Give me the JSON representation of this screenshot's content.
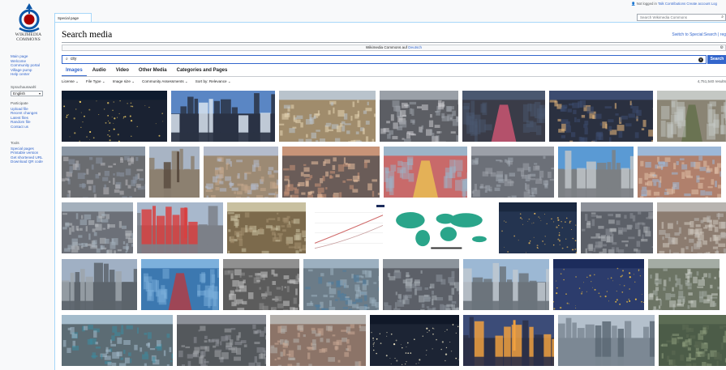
{
  "logo": {
    "line1": "WIKIMEDIA",
    "line2": "COMMONS"
  },
  "sidebar": {
    "nav": [
      "Main page",
      "Welcome",
      "Community portal",
      "Village pump",
      "Help center"
    ],
    "language_heading": "Sprachauswahl",
    "language_value": "English",
    "participate_heading": "Participate",
    "participate": [
      "Upload file",
      "Recent changes",
      "Latest files",
      "Random file",
      "Contact us"
    ],
    "tools_heading": "Tools",
    "tools": [
      "Special pages",
      "Printable version",
      "Get shortened URL",
      "Download QR code"
    ]
  },
  "topbar": {
    "user_status": "Not logged in",
    "links": [
      "Talk",
      "Contributions",
      "Create account",
      "Log"
    ],
    "search_placeholder": "Search Wikimedia Commons"
  },
  "page": {
    "tab": "Special page",
    "title": "Search media",
    "switch_link": "Switch to Special:Search | reg",
    "banner_text": "Wikimedia Commons auf ",
    "banner_link": "Deutsch",
    "query": "city",
    "search_button": "Search",
    "media_tabs": [
      "Images",
      "Audio",
      "Video",
      "Other Media",
      "Categories and Pages"
    ],
    "filters": [
      "License",
      "File Type",
      "Image size",
      "Community Assessments",
      "Sort by: Relevance"
    ],
    "results_count": "4,751,540 results"
  },
  "colors": {
    "link": "#3366cc",
    "accent": "#3366cc",
    "border": "#a7d7f9"
  },
  "thumbs": [
    {
      "alt": "city-lights-night-earth",
      "sky": "#0d1b2e",
      "ground": "#1a2232",
      "accent": "#e8c864",
      "style": "night"
    },
    {
      "alt": "manhattan-skyline-dusk",
      "sky": "#5a86c4",
      "ground": "#2a3244",
      "accent": "#d9e4f0",
      "style": "skyline"
    },
    {
      "alt": "vatican-piazza-aerial",
      "sky": "#b9c3cc",
      "ground": "#a08c6c",
      "accent": "#e6d6b4",
      "style": "aerial"
    },
    {
      "alt": "new-york-aerial-grey",
      "sky": "#9aa0a8",
      "ground": "#5c5e64",
      "accent": "#c8c8cc",
      "style": "dense"
    },
    {
      "alt": "tokyo-shibuya-crossing",
      "sky": "#4a5870",
      "ground": "#3a3c48",
      "accent": "#e85a7a",
      "style": "street"
    },
    {
      "alt": "hong-kong-harbour-night",
      "sky": "#3c4c70",
      "ground": "#2a3040",
      "accent": "#f0c080",
      "style": "dense"
    },
    {
      "alt": "paris-boulevard-trees",
      "sky": "#c4c8c4",
      "ground": "#8a8474",
      "accent": "#5c6c44",
      "style": "street"
    },
    {
      "alt": "midtown-aerial-day",
      "sky": "#8a96a4",
      "ground": "#6a6c70",
      "accent": "#b8b8bc",
      "style": "dense"
    },
    {
      "alt": "paris-eiffel-tower",
      "sky": "#a8b4c4",
      "ground": "#8c8070",
      "accent": "#5a4c40",
      "style": "tower"
    },
    {
      "alt": "european-rooftops",
      "sky": "#b4bccc",
      "ground": "#9c8a74",
      "accent": "#c4a88c",
      "style": "aerial"
    },
    {
      "alt": "paris-sunset-panorama",
      "sky": "#c89478",
      "ground": "#6a5c58",
      "accent": "#e8c0a0",
      "style": "aerial"
    },
    {
      "alt": "colorful-pedestrian-street",
      "sky": "#9cb4c8",
      "ground": "#c86a6a",
      "accent": "#f0d050",
      "style": "street"
    },
    {
      "alt": "city-river-aerial",
      "sky": "#9ca0a8",
      "ground": "#6c7078",
      "accent": "#a0a8b0",
      "style": "aerial"
    },
    {
      "alt": "modern-city-blue-sky",
      "sky": "#5a9ad4",
      "ground": "#7c8084",
      "accent": "#c0c4c8",
      "style": "skyline"
    },
    {
      "alt": "old-town-rooftops",
      "sky": "#9cb8d8",
      "ground": "#b0806c",
      "accent": "#e0c0a8",
      "style": "aerial"
    },
    {
      "alt": "downtown-highway-aerial",
      "sky": "#a4b0bc",
      "ground": "#6c7078",
      "accent": "#b8bcc0",
      "style": "dense"
    },
    {
      "alt": "tokyo-tower-skyline",
      "sky": "#a8b8cc",
      "ground": "#7c8088",
      "accent": "#d84040",
      "style": "tower"
    },
    {
      "alt": "historic-painting-city",
      "sky": "#c8c0a0",
      "ground": "#7c6a4c",
      "accent": "#a49070",
      "style": "aerial"
    },
    {
      "alt": "urbanization-line-chart",
      "sky": "#ffffff",
      "ground": "#ffffff",
      "accent": "#d06a6a",
      "style": "chart"
    },
    {
      "alt": "urbanization-world-map",
      "sky": "#ffffff",
      "ground": "#ffffff",
      "accent": "#2aa58a",
      "style": "map"
    },
    {
      "alt": "city-night-lights-aerial",
      "sky": "#1a2840",
      "ground": "#243450",
      "accent": "#e8b85c",
      "style": "night"
    },
    {
      "alt": "skyscrapers-aerial-grey",
      "sky": "#8c9098",
      "ground": "#5c6068",
      "accent": "#b0b4b8",
      "style": "dense"
    },
    {
      "alt": "river-bend-city-haze",
      "sky": "#b8b4b0",
      "ground": "#8c7c70",
      "accent": "#d0c8c0",
      "style": "aerial"
    },
    {
      "alt": "business-district-towers",
      "sky": "#a0b0c4",
      "ground": "#5c646c",
      "accent": "#9ca4ac",
      "style": "skyline"
    },
    {
      "alt": "waterfront-red-figure",
      "sky": "#7cb0dc",
      "ground": "#3c78b0",
      "accent": "#c83030",
      "style": "street"
    },
    {
      "alt": "city-aerial-black-white",
      "sky": "#909090",
      "ground": "#5c5c5c",
      "accent": "#c4c4c4",
      "style": "dense"
    },
    {
      "alt": "coastal-city-aerial",
      "sky": "#9cb0c0",
      "ground": "#6c7c88",
      "accent": "#4c7ca0",
      "style": "aerial"
    },
    {
      "alt": "city-overview-grey",
      "sky": "#8c949c",
      "ground": "#5c6068",
      "accent": "#a8aeb4",
      "style": "dense"
    },
    {
      "alt": "skyline-river-day",
      "sky": "#9cb8d4",
      "ground": "#6c747c",
      "accent": "#c0c8d0",
      "style": "skyline"
    },
    {
      "alt": "old-town-night-river",
      "sky": "#1c2c5c",
      "ground": "#2c3c6c",
      "accent": "#f0c040",
      "style": "night"
    },
    {
      "alt": "city-rooftops-mist",
      "sky": "#a4aca4",
      "ground": "#6c7464",
      "accent": "#c8ccc4",
      "style": "aerial"
    },
    {
      "alt": "industrial-city-aerial",
      "sky": "#a4bccc",
      "ground": "#5c6c74",
      "accent": "#3c8ca0",
      "style": "dense"
    },
    {
      "alt": "downtown-street-aerial",
      "sky": "#8c9098",
      "ground": "#54585c",
      "accent": "#a0a4a8",
      "style": "dense"
    },
    {
      "alt": "european-town-rooftops",
      "sky": "#b4b0ac",
      "ground": "#8c7468",
      "accent": "#c8a894",
      "style": "aerial"
    },
    {
      "alt": "tv-tower-night-skyline",
      "sky": "#101828",
      "ground": "#1c2434",
      "accent": "#e8e0c0",
      "style": "night"
    },
    {
      "alt": "illuminated-tower-dusk",
      "sky": "#3c4c78",
      "ground": "#2c3048",
      "accent": "#f0a040",
      "style": "tower"
    },
    {
      "alt": "harbour-pier-skyline",
      "sky": "#b4c0cc",
      "ground": "#7c8894",
      "accent": "#5c6874",
      "style": "skyline"
    },
    {
      "alt": "satellite-city-view",
      "sky": "#5c6c54",
      "ground": "#4c5c48",
      "accent": "#8c9c7c",
      "style": "aerial"
    }
  ]
}
